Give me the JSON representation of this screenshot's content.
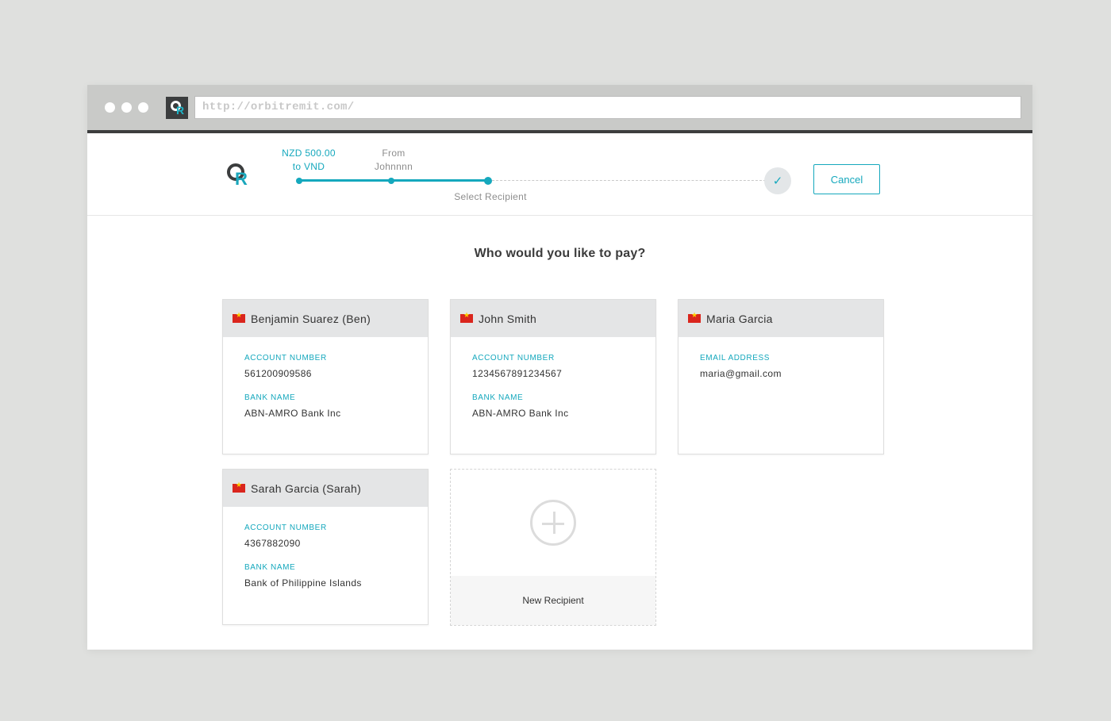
{
  "browser": {
    "url": "http://orbitremit.com/"
  },
  "progress": {
    "step1_line1": "NZD 500.00",
    "step1_line2": "to VND",
    "step2_line1": "From",
    "step2_line2": "Johnnnn",
    "step3": "Select Recipient",
    "cancel_label": "Cancel"
  },
  "main": {
    "question": "Who would you like to pay?",
    "recipients": [
      {
        "name": "Benjamin Suarez (Ben)",
        "fields": [
          {
            "label": "ACCOUNT NUMBER",
            "value": "561200909586"
          },
          {
            "label": "BANK NAME",
            "value": "ABN-AMRO Bank Inc"
          }
        ]
      },
      {
        "name": "John Smith",
        "fields": [
          {
            "label": "ACCOUNT NUMBER",
            "value": "1234567891234567"
          },
          {
            "label": "BANK NAME",
            "value": "ABN-AMRO Bank Inc"
          }
        ]
      },
      {
        "name": "Maria Garcia",
        "fields": [
          {
            "label": "EMAIL ADDRESS",
            "value": "maria@gmail.com"
          }
        ]
      },
      {
        "name": "Sarah Garcia (Sarah)",
        "fields": [
          {
            "label": "ACCOUNT NUMBER",
            "value": "4367882090"
          },
          {
            "label": "BANK NAME",
            "value": "Bank of Philippine Islands"
          }
        ]
      }
    ],
    "new_recipient_label": "New Recipient"
  },
  "colors": {
    "accent": "#15a8bd",
    "header_bg": "#e4e5e6",
    "flag_red": "#da251d",
    "flag_star": "#ffcd00"
  }
}
